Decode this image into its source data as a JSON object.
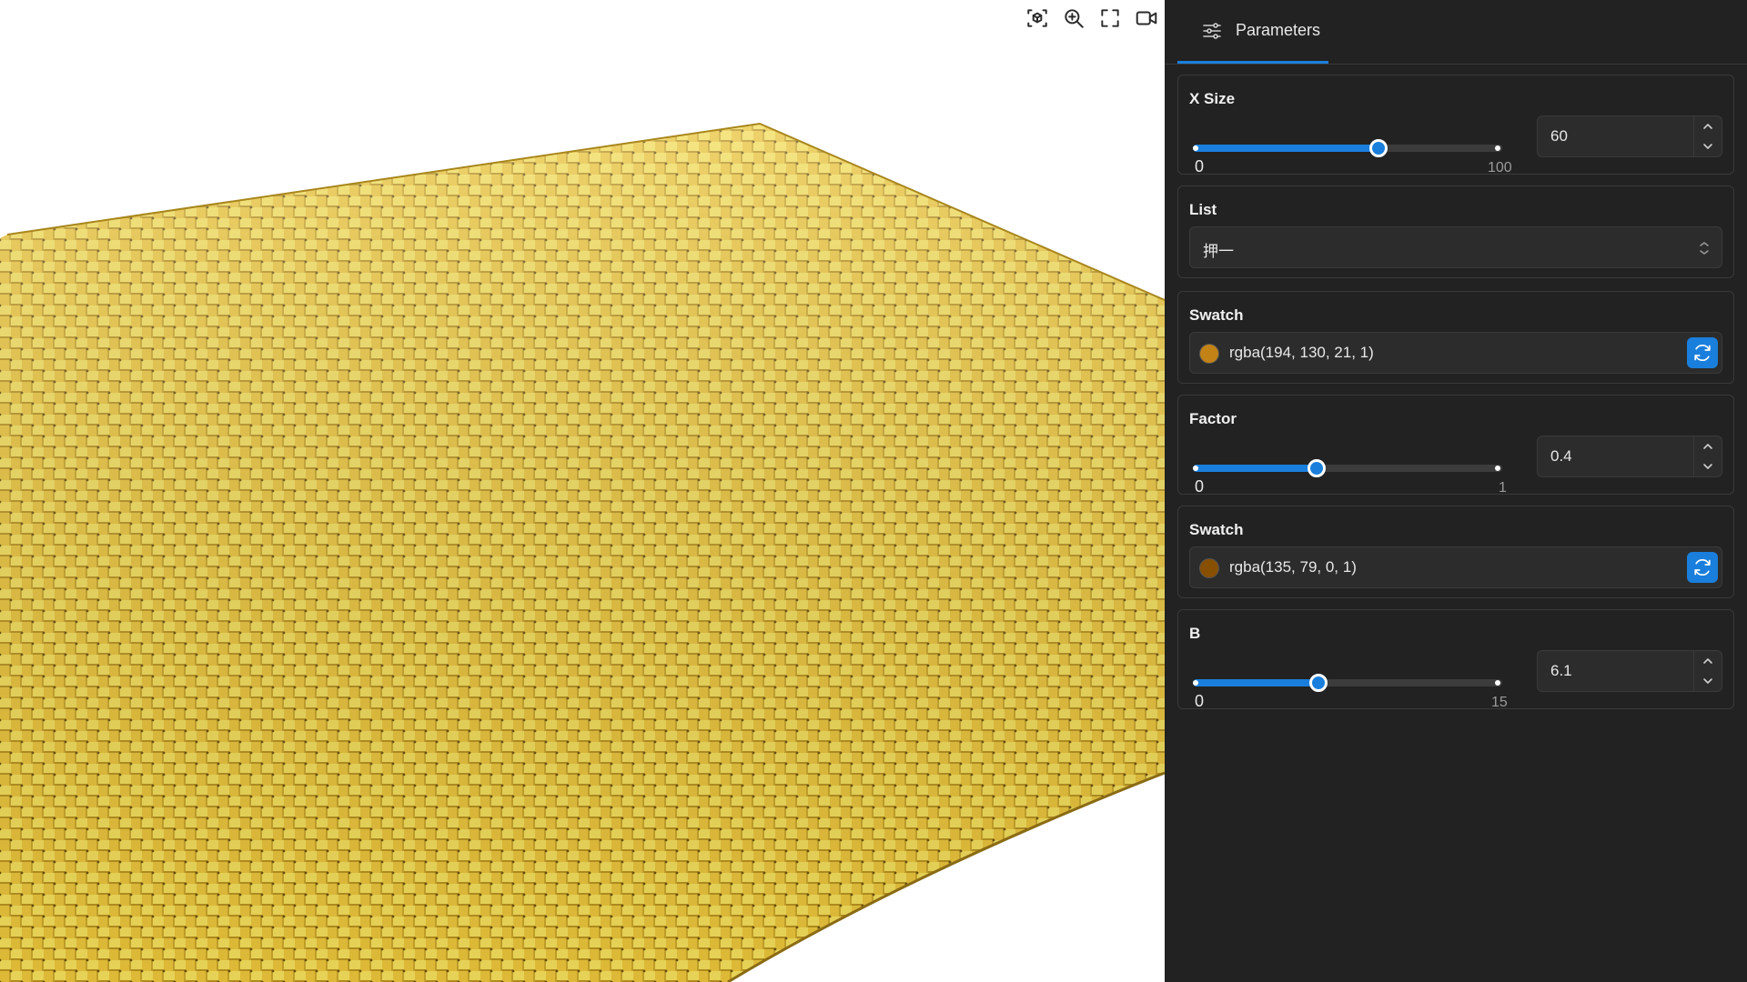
{
  "viewport": {
    "toolbar": [
      {
        "name": "camera-focus-icon"
      },
      {
        "name": "zoom-in-icon"
      },
      {
        "name": "fullscreen-icon"
      },
      {
        "name": "video-camera-icon"
      }
    ],
    "mesh_colors": {
      "light": "#f2dd5a",
      "mid": "#e9c33a",
      "dark": "#b8921f",
      "shadow": "#6b5210"
    }
  },
  "panel": {
    "tab_label": "Parameters",
    "tab_icon": "sliders-icon",
    "accent": "#1a7fdc",
    "x_size": {
      "label": "X Size",
      "min": "0",
      "max": "100",
      "value": "60",
      "fraction": 0.6
    },
    "list": {
      "label": "List",
      "selected": "押一"
    },
    "swatch1": {
      "label": "Swatch",
      "text": "rgba(194, 130, 21, 1)",
      "color": "#c28215"
    },
    "factor": {
      "label": "Factor",
      "min": "0",
      "max": "1",
      "value": "0.4",
      "fraction": 0.4
    },
    "swatch2": {
      "label": "Swatch",
      "text": "rgba(135, 79, 0, 1)",
      "color": "#874f00"
    },
    "b": {
      "label": "B",
      "min": "0",
      "max": "15",
      "value": "6.1",
      "fraction": 0.4067
    }
  }
}
